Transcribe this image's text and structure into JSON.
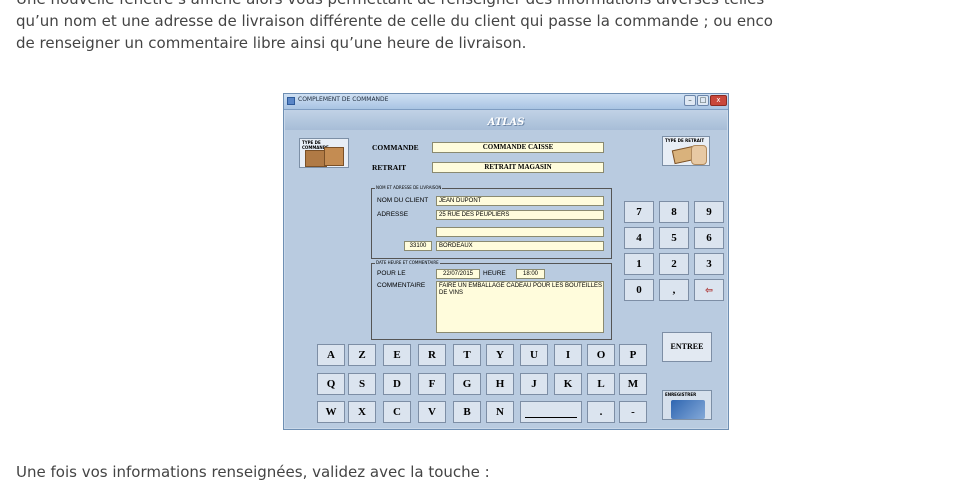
{
  "doc": {
    "p1": "Une nouvelle fenêtre s’affiche alors vous permettant de renseigner des informations diverses telles",
    "p2": "qu’un nom et une adresse de livraison différente de celle du client qui passe la commande ; ou enco",
    "p3": "de renseigner un commentaire libre ainsi qu’une heure de livraison.",
    "p4": "Une fois vos informations renseignées, validez avec la touche :"
  },
  "window": {
    "title": "COMPLEMENT DE COMMANDE",
    "app_title": "ATLAS",
    "controls": {
      "minimize": "–",
      "maximize": "□",
      "close": "x"
    }
  },
  "order": {
    "type_caption": "TYPE DE COMMANDE",
    "retrait_caption": "TYPE DE RETRAIT",
    "commande_label": "COMMANDE",
    "commande_value": "COMMANDE CAISSE",
    "retrait_label": "RETRAIT",
    "retrait_value": "RETRAIT MAGASIN"
  },
  "address": {
    "group_label": "NOM ET ADRESSE DE LIVRAISON",
    "name_label": "NOM DU CLIENT",
    "name_value": "JEAN DUPONT",
    "address_label": "ADRESSE",
    "address_line1": "25 RUE DES PEUPLIERS",
    "address_line2": "",
    "postcode": "33100",
    "city": "BORDEAUX"
  },
  "delivery": {
    "group_label": "DATE HEURE ET COMMENTAIRE",
    "date_label": "POUR LE",
    "date_value": "22/07/2015",
    "hour_label": "HEURE",
    "hour_value": "18:00",
    "comment_label": "COMMENTAIRE",
    "comment_value": "FAIRE UN EMBALLAGE CADEAU POUR LES BOUTEILLES DE VINS"
  },
  "numpad": {
    "rows": [
      [
        "7",
        "8",
        "9"
      ],
      [
        "4",
        "5",
        "6"
      ],
      [
        "1",
        "2",
        "3"
      ],
      [
        "0",
        ",",
        "⇦"
      ]
    ]
  },
  "keyboard": {
    "row1": [
      "A",
      "Z",
      "E",
      "R",
      "T",
      "Y",
      "U",
      "I",
      "O",
      "P"
    ],
    "row2": [
      "Q",
      "S",
      "D",
      "F",
      "G",
      "H",
      "J",
      "K",
      "L",
      "M"
    ],
    "row3": [
      "W",
      "X",
      "C",
      "V",
      "B",
      "N"
    ],
    "dot": ".",
    "dash": "-"
  },
  "actions": {
    "enter": "ENTREE",
    "save_caption": "ENREGISTRER"
  }
}
